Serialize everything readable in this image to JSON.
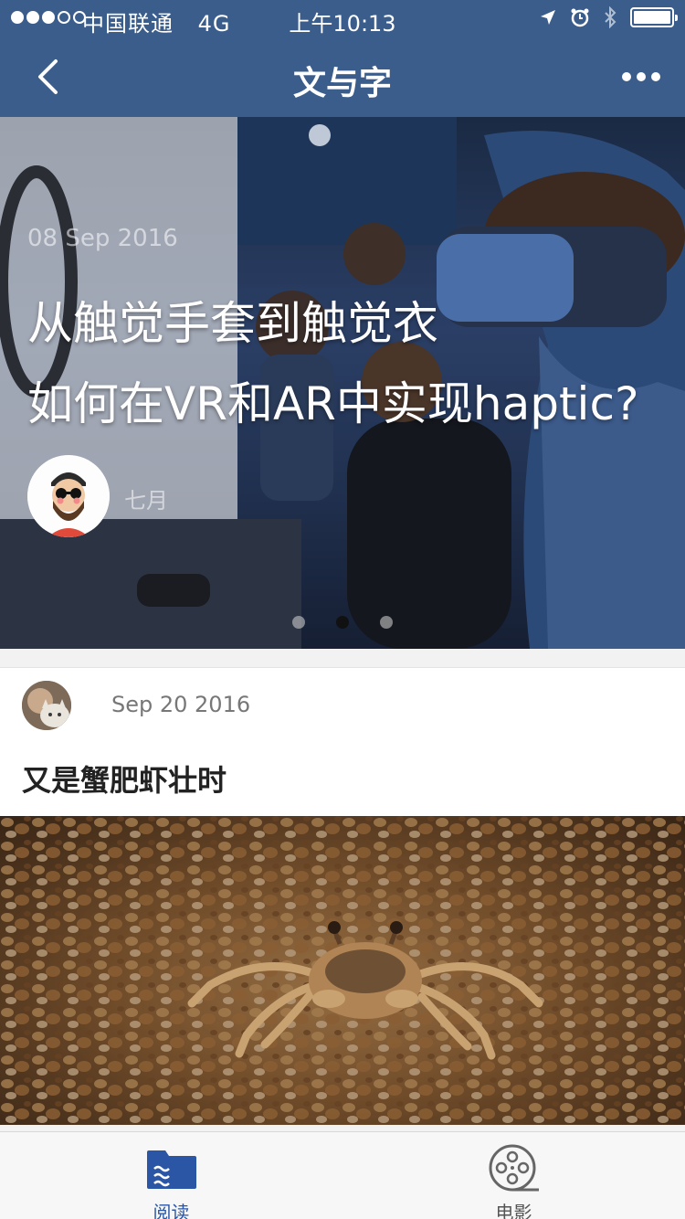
{
  "status_bar": {
    "carrier": "中国联通",
    "network": "4G",
    "time": "上午10:13",
    "signal_strength": 3,
    "battery_level": 1.0
  },
  "nav": {
    "title": "文与字",
    "back_icon": "chevron-left-icon",
    "more_icon": "more-dots-icon"
  },
  "banner": {
    "date": "08 Sep 2016",
    "title_line1": "从触觉手套到触觉衣",
    "title_line2": "如何在VR和AR中实现haptic?",
    "author": "七月",
    "pagination": {
      "count": 3,
      "active_index": 1
    }
  },
  "article": {
    "date": "Sep 20 2016",
    "title": "又是蟹肥虾壮时"
  },
  "tabbar": {
    "items": [
      {
        "label": "阅读",
        "icon": "reading-icon",
        "active": true
      },
      {
        "label": "电影",
        "icon": "film-reel-icon",
        "active": false
      }
    ]
  },
  "colors": {
    "nav_background": "#3a5d8c",
    "tab_active": "#2a56a5",
    "tab_inactive": "#555555"
  }
}
